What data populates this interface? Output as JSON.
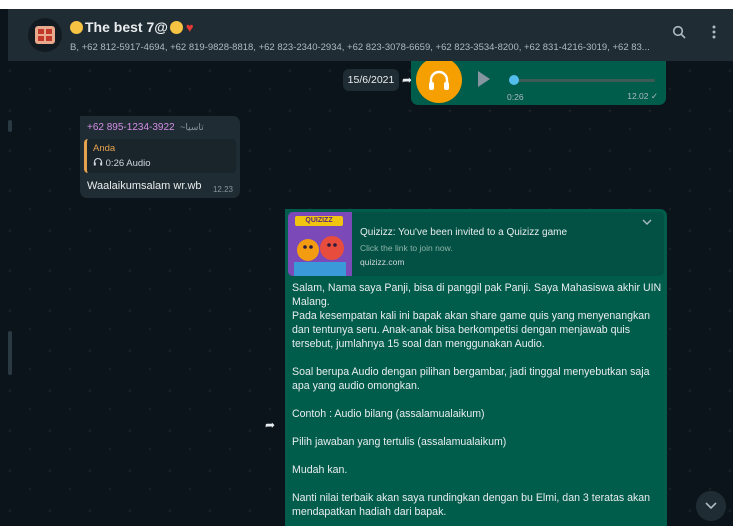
{
  "header": {
    "group_name": "The best 7@",
    "members": "B, +62 812-5917-4694, +62 819-9828-8818, +62 823-2340-2934, +62 823-3078-6659, +62 823-3534-8200, +62 831-4216-3019, +62 83..."
  },
  "icons": {
    "search": "search-icon",
    "menu": "menu-icon",
    "forward": "forward-icon",
    "mic": "mic-icon",
    "play": "play-icon",
    "chevron": "chevron-down-icon"
  },
  "colors": {
    "outgoing_bubble": "#005c4b",
    "incoming_bubble": "#202c33",
    "header": "#202c33",
    "background": "#0b141a",
    "audio_accent": "#f59f00",
    "sender_name": "#d48ee8",
    "quote_accent": "#e6a24e"
  },
  "messages": {
    "audio": {
      "date": "15/6/2021",
      "duration": "0:26",
      "time": "12.02 ✓",
      "progress": 0
    },
    "incoming": {
      "sender": "+62 895-1234-3922",
      "sender_alias": "~تاسيا",
      "quote_name": "Anda",
      "quote_text": "0:26 Audio",
      "text": "Waalaikumsalam wr.wb",
      "time": "12.23"
    },
    "outgoing": {
      "preview_title": "Quizizz: You've been invited to a Quizizz game",
      "preview_desc": "Click the link to join now.",
      "preview_domain": "quizizz.com",
      "thumb_label": "QUIZIZZ",
      "paragraphs": [
        "Salam, Nama saya Panji, bisa di panggil pak Panji. Saya Mahasiswa akhir UIN Malang.\nPada kesempatan kali ini bapak akan share game quis yang menyenangkan dan tentunya seru. Anak-anak bisa berkompetisi dengan menjawab quis tersebut, jumlahnya 15 soal dan menggunakan Audio.",
        "Soal berupa Audio dengan pilihan bergambar, jadi tinggal menyebutkan saja apa yang audio omongkan.",
        "Contoh : Audio bilang (assalamualaikum)",
        "Pilih jawaban yang tertulis (assalamualaikum)",
        "Mudah kan.",
        "Nanti nilai terbaik akan saya rundingkan dengan bu Elmi, dan 3 teratas akan mendapatkan hadiah dari bapak."
      ]
    }
  }
}
